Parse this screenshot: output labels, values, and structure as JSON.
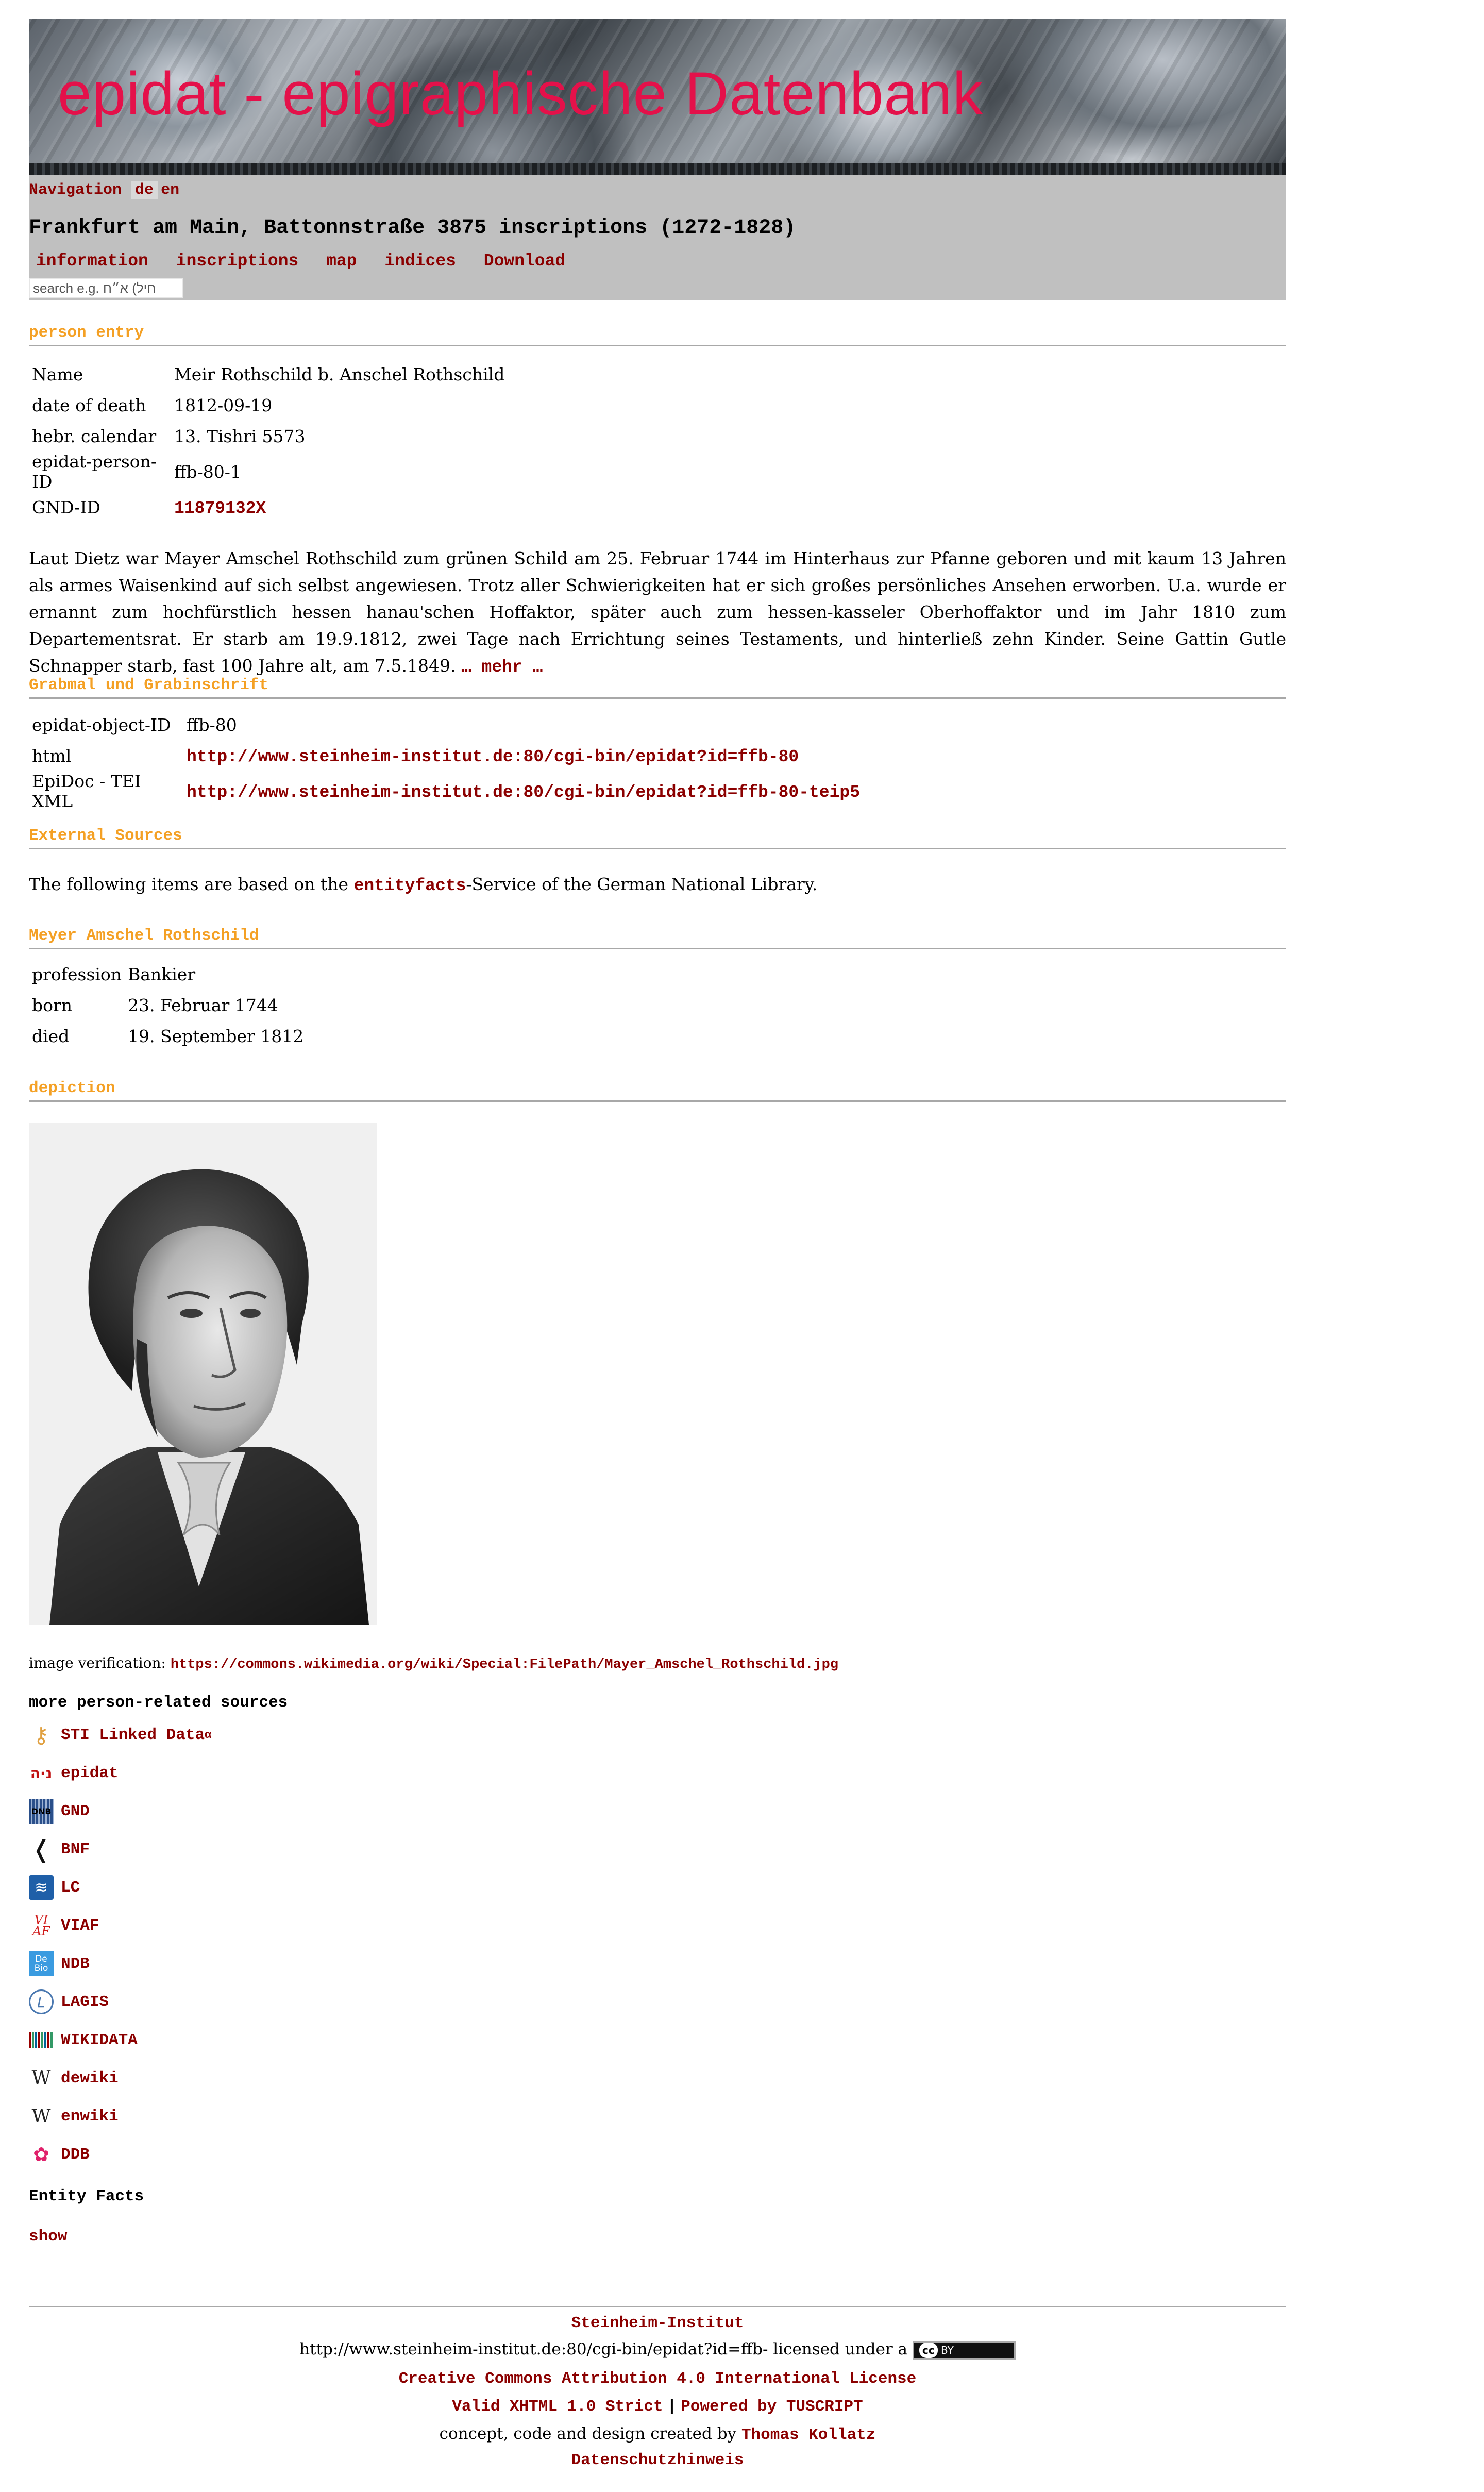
{
  "banner": {
    "title": "epidat - epigraphische Datenbank"
  },
  "nav": {
    "label": "Navigation",
    "lang_de": "de",
    "lang_en": "en",
    "corpus_title": "Frankfurt am Main, Battonnstraße 3875 inscriptions (1272-1828)",
    "menu": [
      "information",
      "inscriptions",
      "map",
      "indices",
      "Download"
    ],
    "search_placeholder": "search e.g. חיל) א״ח"
  },
  "person_entry": {
    "heading": "person entry",
    "rows": [
      {
        "key": "Name",
        "value": "Meir Rothschild b. Anschel Rothschild"
      },
      {
        "key": "date of death",
        "value": "1812-09-19"
      },
      {
        "key": "hebr. calendar",
        "value": "13. Tishri 5573"
      },
      {
        "key": "epidat-person-ID",
        "value": "ffb-80-1"
      },
      {
        "key": "GND-ID",
        "value": "11879132X"
      }
    ],
    "bio": "Laut Dietz war Mayer Amschel Rothschild zum grünen Schild am 25. Februar 1744 im Hinterhaus zur Pfanne geboren und mit kaum 13 Jahren als armes Waisenkind auf sich selbst angewiesen. Trotz aller Schwierigkeiten hat er sich großes persönliches Ansehen erworben. U.a. wurde er ernannt zum hochfürstlich hessen hanau'schen Hoffaktor, später auch zum hessen-kasseler Oberhoffaktor und im Jahr 1810 zum Departementsrat. Er starb am 19.9.1812, zwei Tage nach Errichtung seines Testaments, und hinterließ zehn Kinder. Seine Gattin Gutle Schnapper starb, fast 100 Jahre alt, am 7.5.1849.",
    "more": "… mehr …"
  },
  "grabmal": {
    "heading": "Grabmal und Grabinschrift",
    "rows": [
      {
        "key": "epidat-object-ID",
        "value": "ffb-80"
      },
      {
        "key": "html",
        "value": "http://www.steinheim-institut.de:80/cgi-bin/epidat?id=ffb-80"
      },
      {
        "key": "EpiDoc - TEI XML",
        "value": "http://www.steinheim-institut.de:80/cgi-bin/epidat?id=ffb-80-teip5"
      }
    ]
  },
  "external": {
    "heading": "External Sources",
    "text_before": "The following items are based on the ",
    "link": "entityfacts",
    "text_after": "-Service of the German National Library."
  },
  "gnd_person": {
    "heading": "Meyer Amschel Rothschild",
    "rows": [
      {
        "key": "profession",
        "value": "Bankier"
      },
      {
        "key": "born",
        "value": "23. Februar 1744"
      },
      {
        "key": "died",
        "value": "19. September 1812"
      }
    ]
  },
  "depiction": {
    "heading": "depiction",
    "verification_label": "image verification: ",
    "verification_url": "https://commons.wikimedia.org/wiki/Special:FilePath/Mayer_Amschel_Rothschild.jpg"
  },
  "more_sources": {
    "heading": "more person-related sources",
    "items": [
      {
        "label": "STI Linked Data",
        "sup": "α",
        "icon": "sti-icon"
      },
      {
        "label": "epidat",
        "icon": "epidat-icon"
      },
      {
        "label": "GND",
        "icon": "gnd-icon"
      },
      {
        "label": "BNF",
        "icon": "bnf-icon"
      },
      {
        "label": "LC",
        "icon": "lc-icon"
      },
      {
        "label": "VIAF",
        "icon": "viaf-icon"
      },
      {
        "label": "NDB",
        "icon": "ndb-icon"
      },
      {
        "label": "LAGIS",
        "icon": "lagis-icon"
      },
      {
        "label": "WIKIDATA",
        "icon": "wikidata-icon"
      },
      {
        "label": "dewiki",
        "icon": "wikipedia-icon"
      },
      {
        "label": "enwiki",
        "icon": "wikipedia-icon"
      },
      {
        "label": "DDB",
        "icon": "ddb-icon"
      }
    ]
  },
  "entity_facts": {
    "heading": "Entity Facts",
    "show": "show"
  },
  "footer": {
    "institute": "Steinheim-Institut",
    "url_text": "http://www.steinheim-institut.de:80/cgi-bin/epidat?id=ffb- licensed under a",
    "cc_badge": "BY",
    "license": "Creative Commons Attribution 4.0 International License",
    "valid": "Valid XHTML 1.0 Strict",
    "powered": "Powered by TUSCRIPT",
    "concept": "concept, code and design created by ",
    "author": "Thomas Kollatz",
    "privacy": "Datenschutzhinweis"
  }
}
